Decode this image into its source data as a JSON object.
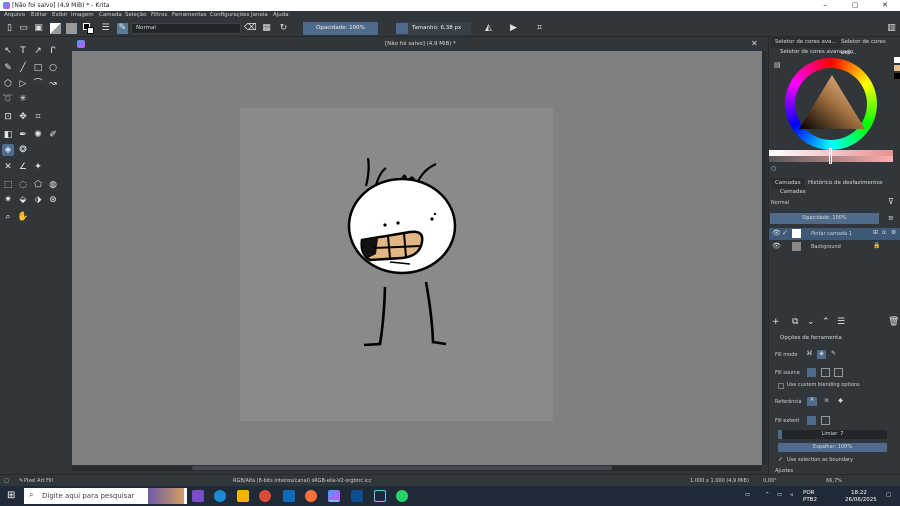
{
  "window": {
    "title": "[Não foi salvo] (4,9 MiB) * - Krita",
    "controls": [
      "–",
      "▢",
      "✕"
    ]
  },
  "menu": [
    "Arquivo",
    "Editar",
    "Exibir",
    "Imagem",
    "Camada",
    "Seleção",
    "Filtros",
    "Ferramentas",
    "Configurações",
    "Janela",
    "Ajuda"
  ],
  "toolbar": {
    "blend_mode": "Normal",
    "opacity": "Opacidade: 100%",
    "size": "Tamanho: 6,38 px"
  },
  "document": {
    "tab_title": "[Não foi salvo] (4,9 MiB) *"
  },
  "color_panel": {
    "tab1": "Seletor de cores ava...",
    "tab2": "Seletor de cores esp...",
    "title": "Seletor de cores avançado"
  },
  "layers_panel": {
    "tab1": "Camadas",
    "tab2": "Histórico de desfazimentos",
    "title": "Camadas",
    "blend_mode": "Normal",
    "opacity": "Opacidade: 100%",
    "layers": [
      {
        "name": "Pintar camada 1",
        "active": true
      },
      {
        "name": "Background",
        "active": false
      }
    ]
  },
  "tool_options": {
    "title": "Opções de ferramenta",
    "fill_mode_label": "Fill mode",
    "fill_source_label": "Fill source",
    "custom_blending": "Use custom blending options",
    "reference_label": "Referência",
    "fill_extent_label": "Fill extent",
    "threshold": "Limiar: 7",
    "spread": "Espalhar: 100%",
    "use_selection": "Use selection as boundary",
    "adjust_label": "Ajustes"
  },
  "status": {
    "tool": "Pixel Art Fill",
    "color_info": "RGB/Alfa (8-bits inteiros/canal)  sRGB-elle-V2-srgbtrc.icc",
    "size_info": "1.000 x 1.000 (4,9 MiB)",
    "rotation": "0,00°",
    "zoom": "66,7%"
  },
  "taskbar": {
    "search_placeholder": "Digite aqui para pesquisar",
    "lang1": "POR",
    "lang2": "PTB2",
    "time": "18:22",
    "date": "26/06/2025"
  }
}
